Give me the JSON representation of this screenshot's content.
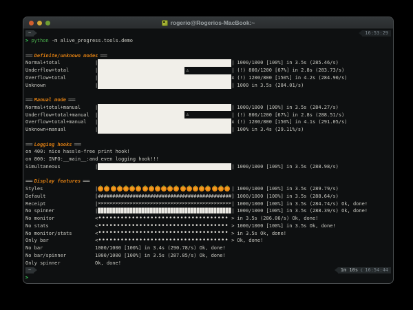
{
  "window": {
    "title": "rogerio@Rogerios-MacBook:~",
    "traffic_lights": {
      "close": "#d15f2e",
      "minimize": "#d3a936",
      "zoom": "#6f9d33"
    }
  },
  "colors": {
    "accent_orange": "#dd7e12",
    "bar_white": "#f1efe9",
    "text": "#c9c9c2",
    "green_prompt": "#3fd95e",
    "green_command": "#4cb34f",
    "muted_time": "#79838a"
  },
  "top_status": {
    "cwd": "~",
    "time": "16:53:29"
  },
  "bottom_status": {
    "cwd": "~",
    "duration": "1m 10s",
    "separator": "❮",
    "time": "16:54:44"
  },
  "command": {
    "prompt": ">",
    "program": "python",
    "args": "-m alive_progress.tools.demo"
  },
  "final_prompt": ">",
  "sections": [
    {
      "title": "Definite/unknown modes",
      "rule": "===",
      "lines": [],
      "rows": [
        {
          "label": "Normal+total",
          "bar": {
            "kind": "solid",
            "open": "|",
            "close": "|",
            "fill_pct": 100
          },
          "stats": "1000/1000 [100%] in 3.5s (285.46/s)"
        },
        {
          "label": "Underflow+total",
          "bar": {
            "kind": "solid",
            "open": "|",
            "close": "|",
            "fill_pct": 65,
            "warn": "⚠"
          },
          "stats": "(!) 800/1200 [67%] in 2.8s (283.73/s)"
        },
        {
          "label": "Overflow+total",
          "bar": {
            "kind": "solid",
            "open": "|",
            "close": "x",
            "fill_pct": 100
          },
          "stats": "(!) 1200/800 [150%] in 4.2s (284.90/s)"
        },
        {
          "label": "Unknown",
          "bar": {
            "kind": "solid",
            "open": "|",
            "close": "|",
            "fill_pct": 100
          },
          "stats": "1000 in 3.5s (284.01/s)"
        }
      ]
    },
    {
      "title": "Manual mode",
      "rule": "===",
      "lines": [],
      "rows": [
        {
          "label": "Normal+total+manual",
          "bar": {
            "kind": "solid",
            "open": "|",
            "close": "|",
            "fill_pct": 100
          },
          "stats": "1000/1000 [100%] in 3.5s (284.27/s)"
        },
        {
          "label": "Underflow+total+manual",
          "bar": {
            "kind": "solid",
            "open": "|",
            "close": "|",
            "fill_pct": 65,
            "warn": "⚠"
          },
          "stats": "(!) 800/1200 [67%] in 2.8s (288.51/s)"
        },
        {
          "label": "Overflow+total+manual",
          "bar": {
            "kind": "solid",
            "open": "|",
            "close": "x",
            "fill_pct": 100
          },
          "stats": "(!) 1200/800 [150%] in 4.1s (291.05/s)"
        },
        {
          "label": "Unknown+manual",
          "bar": {
            "kind": "solid",
            "open": "|",
            "close": "|",
            "fill_pct": 100
          },
          "stats": "100% in 3.4s (29.11%/s)"
        }
      ]
    },
    {
      "title": "Logging hooks",
      "rule": "===",
      "lines": [
        "on 400: nice hassle-free print hook!",
        "on 800: INFO:__main__:and even logging hook!!!"
      ],
      "rows": [
        {
          "label": "Simultaneous",
          "bar": {
            "kind": "solid",
            "open": "|",
            "close": "|",
            "fill_pct": 100
          },
          "stats": "1000/1000 [100%] in 3.5s (288.98/s)"
        }
      ]
    },
    {
      "title": "Display features",
      "rule": "===",
      "lines": [],
      "rows": [
        {
          "label": "Styles",
          "bar": {
            "kind": "pumpkins",
            "open": "|",
            "close": "|",
            "count": 21
          },
          "stats": "1000/1000 [100%] in 3.5s (289.79/s)"
        },
        {
          "label": "Default",
          "bar": {
            "kind": "chars",
            "open": "[",
            "close": "]",
            "char": "#",
            "count": 46
          },
          "stats": "1000/1000 [100%] in 3.5s (288.64/s)"
        },
        {
          "label": "Receipt",
          "bar": {
            "kind": "chars",
            "open": "|",
            "close": "|",
            "char": ">",
            "count": 46
          },
          "stats": "1000/1000 [100%] in 3.5s (284.74/s) Ok, done!"
        },
        {
          "label": "No spinner",
          "bar": {
            "kind": "chars",
            "open": "|",
            "close": "|",
            "char": "▉",
            "count": 46
          },
          "stats": "1000/1000 [100%] in 3.5s (288.39/s) Ok, done!"
        },
        {
          "label": "No monitor",
          "bar": {
            "kind": "chars",
            "open": "<",
            "close": ">",
            "char": "•",
            "count": 35
          },
          "stats": "in 3.5s (286.06/s) Ok, done!"
        },
        {
          "label": "No stats",
          "bar": {
            "kind": "chars",
            "open": "<",
            "close": ">",
            "char": "•",
            "count": 35
          },
          "stats": "1000/1000 [100%] in 3.5s Ok, done!"
        },
        {
          "label": "No monitor/stats",
          "bar": {
            "kind": "chars",
            "open": "<",
            "close": ">",
            "char": "•",
            "count": 35
          },
          "stats": "in 3.5s Ok, done!"
        },
        {
          "label": "Only bar",
          "bar": {
            "kind": "chars",
            "open": "<",
            "close": ">",
            "char": "•",
            "count": 35
          },
          "stats": "Ok, done!"
        },
        {
          "label": "No bar",
          "bar": {
            "kind": "none"
          },
          "stats": "1000/1000 [100%] in 3.4s (290.78/s) Ok, done!"
        },
        {
          "label": "No bar/spinner",
          "bar": {
            "kind": "none"
          },
          "stats": "1000/1000 [100%] in 3.5s (287.85/s) Ok, done!"
        },
        {
          "label": "Only spinner",
          "bar": {
            "kind": "none"
          },
          "stats": "Ok, done!"
        }
      ]
    }
  ]
}
